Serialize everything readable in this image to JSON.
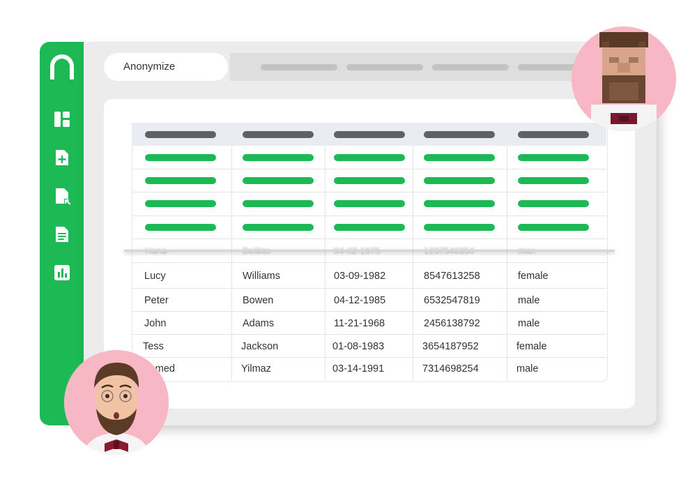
{
  "app": {
    "search_label": "Anonymize"
  },
  "sidebar": {
    "items": [
      {
        "icon": "dashboard-icon"
      },
      {
        "icon": "add-file-icon"
      },
      {
        "icon": "export-file-icon"
      },
      {
        "icon": "document-icon"
      },
      {
        "icon": "bar-chart-icon"
      }
    ]
  },
  "table": {
    "blurred_row": [
      "Hana",
      "Delikto",
      "04-02-1975",
      "1237540354",
      "man"
    ],
    "rows": [
      {
        "first": "Lucy",
        "last": "Williams",
        "dob": "03-09-1982",
        "phone": "8547613258",
        "gender": "female"
      },
      {
        "first": "Peter",
        "last": "Bowen",
        "dob": "04-12-1985",
        "phone": "6532547819",
        "gender": "male"
      },
      {
        "first": "John",
        "last": "Adams",
        "dob": "11-21-1968",
        "phone": "2456138792",
        "gender": "male"
      },
      {
        "first": "Tess",
        "last": "Jackson",
        "dob": "01-08-1983",
        "phone": "3654187952",
        "gender": "female"
      },
      {
        "first": "Ahmed",
        "last": "Yilmaz",
        "dob": "03-14-1991",
        "phone": "7314698254",
        "gender": "male"
      }
    ]
  },
  "colors": {
    "brand_green": "#1db954",
    "header_pill": "#5f6166",
    "avatar_bg": "#f7b7c4"
  }
}
